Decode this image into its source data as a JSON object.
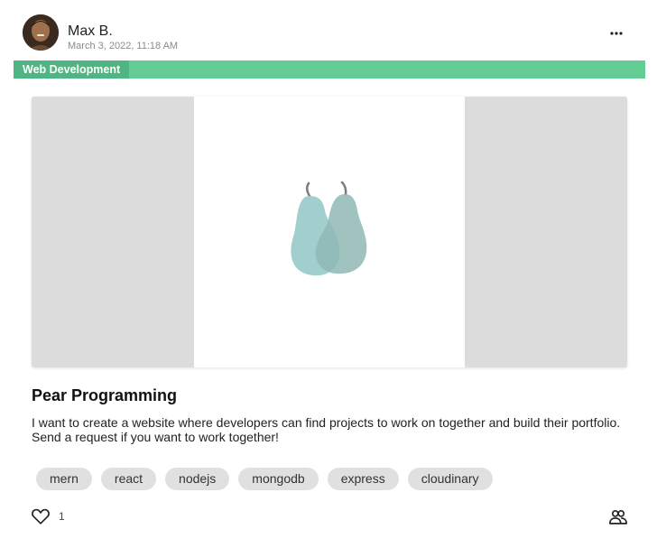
{
  "post": {
    "author": "Max B.",
    "timestamp": "March 3, 2022, 11:18 AM",
    "category": "Web Development",
    "title": "Pear Programming",
    "description": "I want to create a website where developers can find projects to work on together and build their portfolio. Send a request if you want to work together!",
    "tags": [
      "mern",
      "react",
      "nodejs",
      "mongodb",
      "express",
      "cloudinary"
    ],
    "like_count": "1"
  },
  "icons": {
    "more": "more-horizontal-icon",
    "like": "heart-outline-icon",
    "members": "people-icon"
  },
  "colors": {
    "category_bar": "#64cd95",
    "category_label": "#4fb582",
    "tag_background": "#e0e0e0",
    "media_background": "#dcdcdc"
  }
}
